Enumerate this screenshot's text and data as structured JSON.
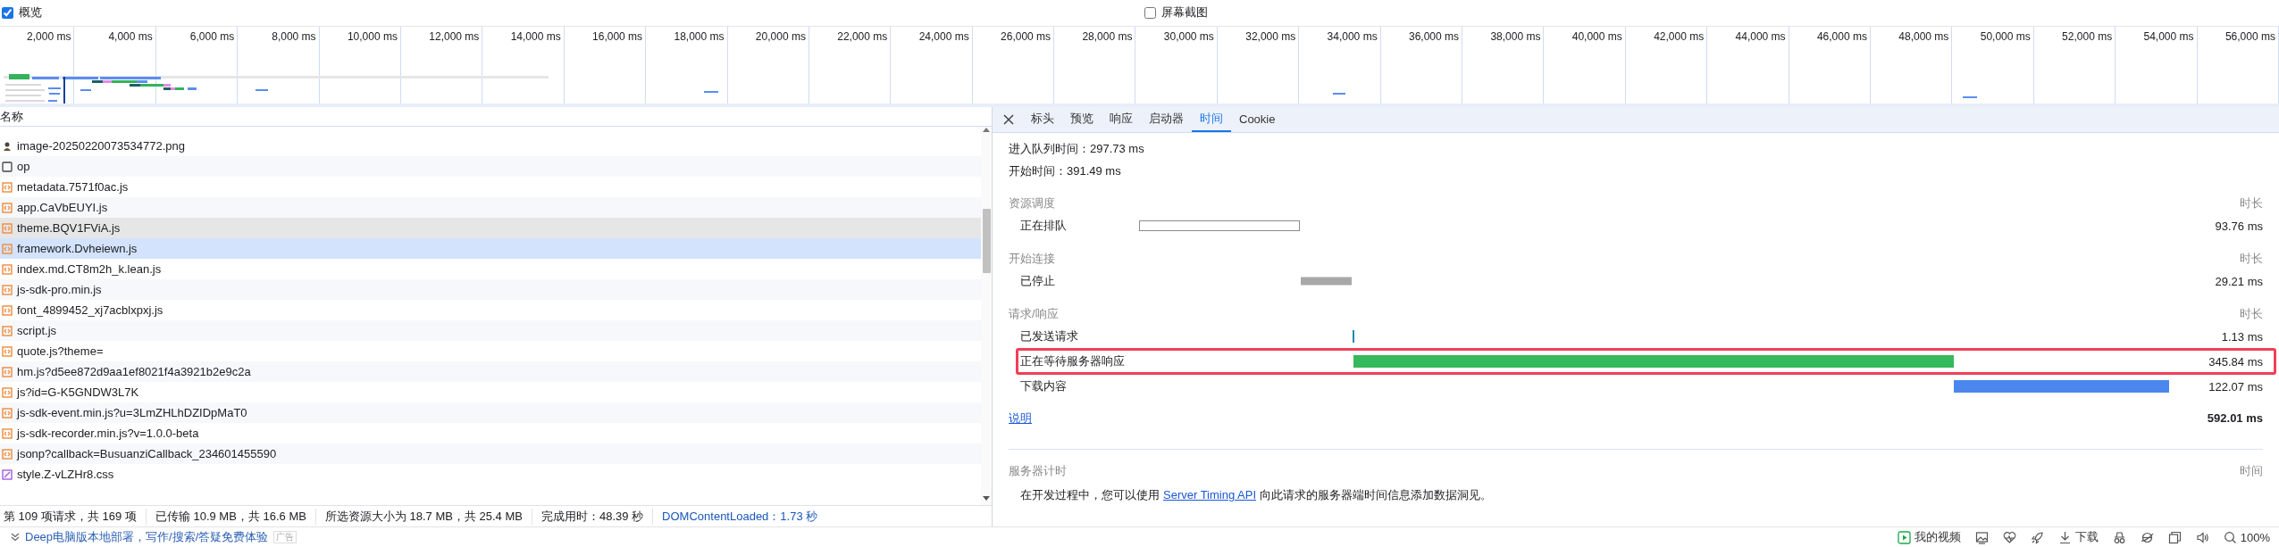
{
  "toolbar": {
    "checkboxes": [
      {
        "label": "概览",
        "checked": true
      },
      {
        "label": "屏幕截图",
        "checked": false
      }
    ]
  },
  "overview": {
    "ticks": [
      "2,000 ms",
      "4,000 ms",
      "6,000 ms",
      "8,000 ms",
      "10,000 ms",
      "12,000 ms",
      "14,000 ms",
      "16,000 ms",
      "18,000 ms",
      "20,000 ms",
      "22,000 ms",
      "24,000 ms",
      "26,000 ms",
      "28,000 ms",
      "30,000 ms",
      "32,000 ms",
      "34,000 ms",
      "36,000 ms",
      "38,000 ms",
      "40,000 ms",
      "42,000 ms",
      "44,000 ms",
      "46,000 ms",
      "48,000 ms",
      "50,000 ms",
      "52,000 ms",
      "54,000 ms",
      "56,000 ms"
    ]
  },
  "requests": {
    "column": "名称",
    "rows": [
      {
        "name": "image-20250220073534772.png",
        "kind": "image",
        "hovered": false,
        "selected": false
      },
      {
        "name": "op",
        "kind": "document",
        "hovered": false,
        "selected": false
      },
      {
        "name": "metadata.7571f0ac.js",
        "kind": "script",
        "hovered": false,
        "selected": false
      },
      {
        "name": "app.CaVbEUYI.js",
        "kind": "script",
        "hovered": false,
        "selected": false
      },
      {
        "name": "theme.BQV1FViA.js",
        "kind": "script",
        "hovered": true,
        "selected": false
      },
      {
        "name": "framework.Dvheiewn.js",
        "kind": "script",
        "hovered": false,
        "selected": true
      },
      {
        "name": "index.md.CT8m2h_k.lean.js",
        "kind": "script",
        "hovered": false,
        "selected": false
      },
      {
        "name": "js-sdk-pro.min.js",
        "kind": "script",
        "hovered": false,
        "selected": false
      },
      {
        "name": "font_4899452_xj7acblxpxj.js",
        "kind": "script",
        "hovered": false,
        "selected": false
      },
      {
        "name": "script.js",
        "kind": "script",
        "hovered": false,
        "selected": false
      },
      {
        "name": "quote.js?theme=",
        "kind": "script",
        "hovered": false,
        "selected": false
      },
      {
        "name": "hm.js?d5ee872d9aa1ef8021f4a3921b2e9c2a",
        "kind": "script",
        "hovered": false,
        "selected": false
      },
      {
        "name": "js?id=G-K5GNDW3L7K",
        "kind": "script",
        "hovered": false,
        "selected": false
      },
      {
        "name": "js-sdk-event.min.js?u=3LmZHLhDZIDpMaT0",
        "kind": "script",
        "hovered": false,
        "selected": false
      },
      {
        "name": "js-sdk-recorder.min.js?v=1.0.0-beta",
        "kind": "script",
        "hovered": false,
        "selected": false
      },
      {
        "name": "jsonp?callback=BusuanziCallback_234601455590",
        "kind": "script",
        "hovered": false,
        "selected": false
      },
      {
        "name": "style.Z-vLZHr8.css",
        "kind": "stylesheet",
        "hovered": false,
        "selected": false
      }
    ]
  },
  "status_bar": [
    {
      "text": "第 109 项请求，共 169 项",
      "kind": "plain"
    },
    {
      "text": "已传输 10.9 MB，共 16.6 MB",
      "kind": "plain"
    },
    {
      "text": "所选资源大小为 18.7 MB，共 25.4 MB",
      "kind": "plain"
    },
    {
      "text": "完成用时：48.39 秒",
      "kind": "plain"
    },
    {
      "text": "DOMContentLoaded：1.73 秒",
      "kind": "event"
    }
  ],
  "details": {
    "tabs": [
      {
        "label": "标头",
        "selected": false
      },
      {
        "label": "预览",
        "selected": false
      },
      {
        "label": "响应",
        "selected": false
      },
      {
        "label": "启动器",
        "selected": false
      },
      {
        "label": "时间",
        "selected": true
      },
      {
        "label": "Cookie",
        "selected": false
      }
    ],
    "info": [
      "进入队列时间：297.73 ms",
      "开始时间：391.49 ms"
    ],
    "sections": [
      {
        "title": "资源调度",
        "duration_heading": "时长",
        "rows": [
          {
            "label": "正在排队",
            "kind": "queued",
            "duration": "93.76 ms",
            "highlighted": false
          }
        ]
      },
      {
        "title": "开始连接",
        "duration_heading": "时长",
        "rows": [
          {
            "label": "已停止",
            "kind": "stalled",
            "duration": "29.21 ms",
            "highlighted": false
          }
        ]
      },
      {
        "title": "请求/响应",
        "duration_heading": "时长",
        "rows": [
          {
            "label": "已发送请求",
            "kind": "sent",
            "duration": "1.13 ms",
            "highlighted": false
          },
          {
            "label": "正在等待服务器响应",
            "kind": "waiting",
            "duration": "345.84 ms",
            "highlighted": true
          },
          {
            "label": "下载内容",
            "kind": "download",
            "duration": "122.07 ms",
            "highlighted": false
          }
        ]
      }
    ],
    "explanation_link": "说明",
    "total": "592.01 ms",
    "server_timing": {
      "title": "服务器计时",
      "time_heading": "时间",
      "note_before": "在开发过程中，您可以使用",
      "link": "Server Timing API",
      "note_after": "向此请求的服务器端时间信息添加数据洞见。"
    }
  },
  "browser_bar": {
    "ad_text": "Deep电脑版本地部署，写作/搜索/答疑免费体验",
    "ad_badge": "广告",
    "video_label": "我的视频",
    "download_label": "下载",
    "zoom": "100%"
  }
}
